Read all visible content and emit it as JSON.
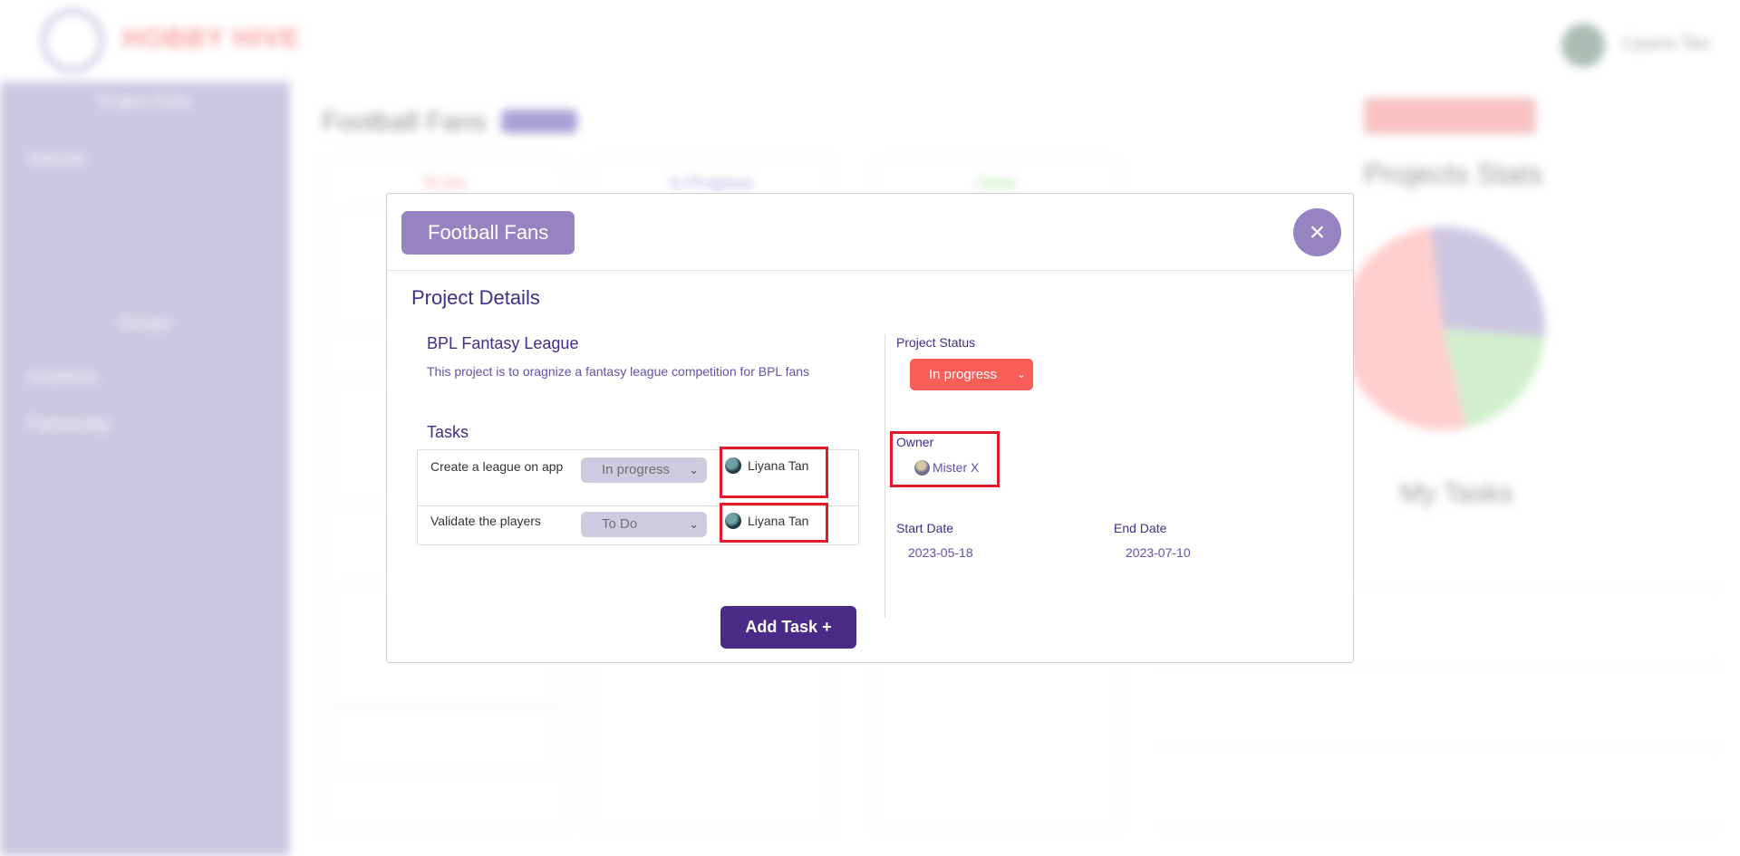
{
  "background": {
    "logo_text": "HOBBY HIVE",
    "user_name": "Liyana Tan",
    "sidebar": {
      "section1_title": "Project Hubs",
      "section1_items": [
        "Website"
      ],
      "section2_title": "Groups",
      "section2_items": [
        "Academic",
        "Partnership"
      ]
    },
    "project_title": "Football Fans",
    "stats_title": "Projects Stats",
    "tasks_title": "My Tasks",
    "columns": [
      "To Do",
      "In Progress",
      "Done"
    ],
    "colors": {
      "todo": "#f46d6d",
      "inprogress": "#7e6fc0",
      "done": "#6fcf5c"
    }
  },
  "modal": {
    "title": "Football Fans",
    "close_label": "×",
    "section_title": "Project Details",
    "project_name": "BPL Fantasy League",
    "project_description": "This project is to oragnize a fantasy league competition for BPL fans",
    "tasks_title": "Tasks",
    "tasks": [
      {
        "name": "Create a league on app",
        "status": "In progress",
        "assignee": "Liyana Tan"
      },
      {
        "name": "Validate the players",
        "status": "To Do",
        "assignee": "Liyana Tan"
      }
    ],
    "project_status_label": "Project Status",
    "project_status": "In progress",
    "owner_label": "Owner",
    "owner_name": "Mister X",
    "start_date_label": "Start Date",
    "start_date": "2023-05-18",
    "end_date_label": "End Date",
    "end_date": "2023-07-10",
    "add_task_label": "Add Task +"
  },
  "colors": {
    "accent": "#9584c1",
    "primary_dark": "#4a2b87",
    "status_red": "#f85d58",
    "highlight_box": "#e01b2b"
  }
}
